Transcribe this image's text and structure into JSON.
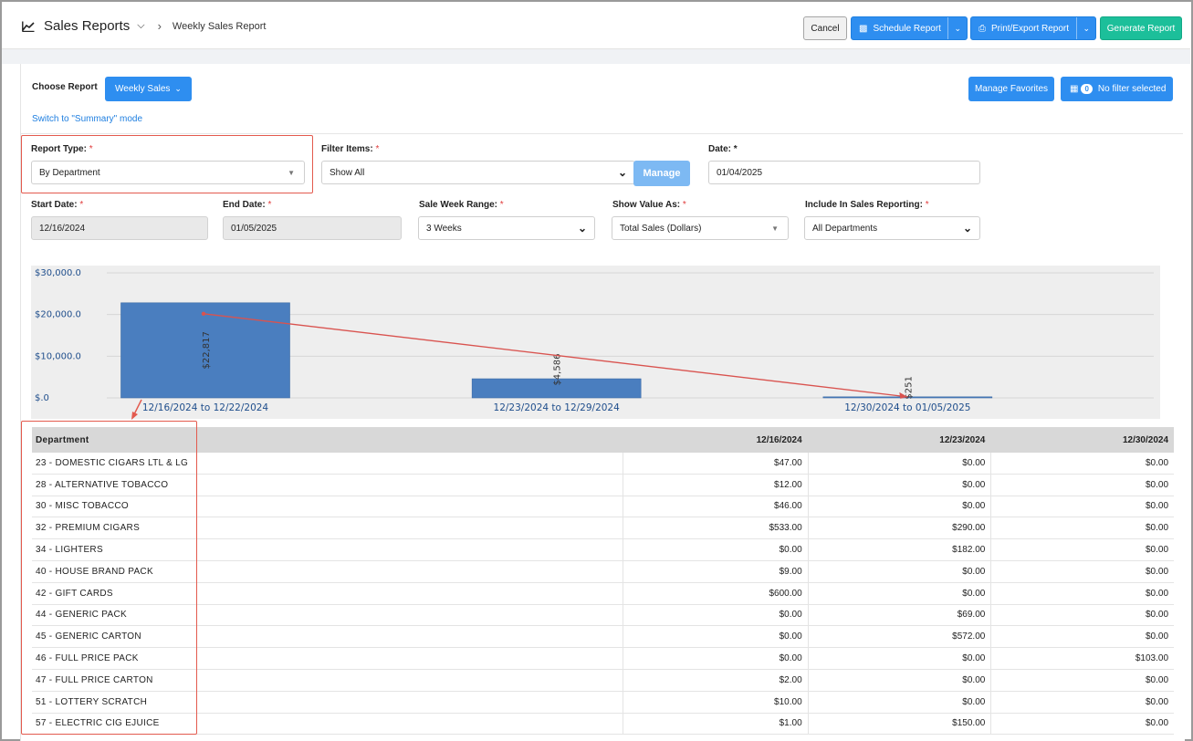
{
  "header": {
    "app_title": "Sales Reports",
    "page_title": "Weekly Sales Report",
    "cancel_label": "Cancel",
    "schedule_label": "Schedule Report",
    "print_label": "Print/Export Report",
    "generate_label": "Generate Report"
  },
  "controls": {
    "choose_report_label": "Choose Report",
    "report_button_label": "Weekly Sales",
    "summary_link": "Switch to \"Summary\" mode",
    "favorites_label": "Manage Favorites",
    "filter_count": "0",
    "filter_label": "No filter selected"
  },
  "form": {
    "report_type_label": "Report Type:",
    "report_type_value": "By Department",
    "filter_items_label": "Filter Items:",
    "filter_items_value": "Show All",
    "manage_label": "Manage",
    "date_label": "Date:",
    "date_value": "01/04/2025",
    "start_date_label": "Start Date:",
    "start_date_value": "12/16/2024",
    "end_date_label": "End Date:",
    "end_date_value": "01/05/2025",
    "week_range_label": "Sale Week Range:",
    "week_range_value": "3 Weeks",
    "show_value_label": "Show Value As:",
    "show_value_value": "Total Sales (Dollars)",
    "include_label": "Include In Sales Reporting:",
    "include_value": "All Departments",
    "required_mark": "*"
  },
  "chart_data": {
    "type": "bar",
    "categories": [
      "12/16/2024 to 12/22/2024",
      "12/23/2024 to 12/29/2024",
      "12/30/2024 to 01/05/2025"
    ],
    "values": [
      22817,
      4586,
      251
    ],
    "value_labels": [
      "$22,817",
      "$4,586",
      "$251"
    ],
    "y_ticks": [
      "$30,000.0",
      "$20,000.0",
      "$10,000.0",
      "$.0"
    ],
    "y_tick_values": [
      30000,
      20000,
      10000,
      0
    ],
    "ylim": [
      0,
      30000
    ],
    "bar_color": "#4a7ebf",
    "trend_line_color": "#d9534f"
  },
  "table": {
    "columns": [
      "Department",
      "12/16/2024",
      "12/23/2024",
      "12/30/2024"
    ],
    "rows": [
      [
        "23 - DOMESTIC CIGARS LTL & LG",
        "$47.00",
        "$0.00",
        "$0.00"
      ],
      [
        "28 - ALTERNATIVE TOBACCO",
        "$12.00",
        "$0.00",
        "$0.00"
      ],
      [
        "30 - MISC TOBACCO",
        "$46.00",
        "$0.00",
        "$0.00"
      ],
      [
        "32 - PREMIUM CIGARS",
        "$533.00",
        "$290.00",
        "$0.00"
      ],
      [
        "34 - LIGHTERS",
        "$0.00",
        "$182.00",
        "$0.00"
      ],
      [
        "40 - HOUSE BRAND PACK",
        "$9.00",
        "$0.00",
        "$0.00"
      ],
      [
        "42 - GIFT CARDS",
        "$600.00",
        "$0.00",
        "$0.00"
      ],
      [
        "44 - GENERIC PACK",
        "$0.00",
        "$69.00",
        "$0.00"
      ],
      [
        "45 - GENERIC CARTON",
        "$0.00",
        "$572.00",
        "$0.00"
      ],
      [
        "46 - FULL PRICE PACK",
        "$0.00",
        "$0.00",
        "$103.00"
      ],
      [
        "47 - FULL PRICE CARTON",
        "$2.00",
        "$0.00",
        "$0.00"
      ],
      [
        "51 - LOTTERY SCRATCH",
        "$10.00",
        "$0.00",
        "$0.00"
      ],
      [
        "57 - ELECTRIC CIG EJUICE",
        "$1.00",
        "$150.00",
        "$0.00"
      ]
    ]
  },
  "colors": {
    "primary": "#2e8ef0",
    "success": "#1cbf9a",
    "highlight": "#e35a4e"
  }
}
